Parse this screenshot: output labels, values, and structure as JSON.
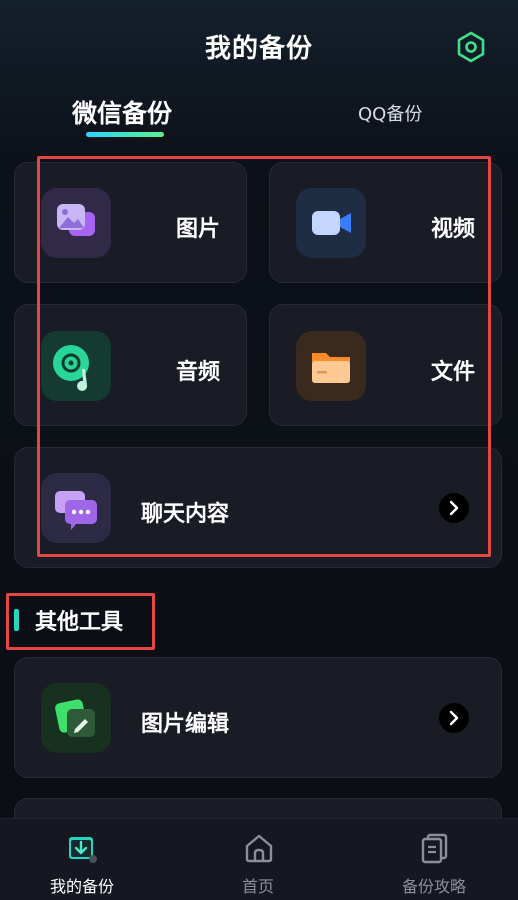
{
  "header": {
    "title": "我的备份",
    "settings_icon": "hexagon-settings-icon"
  },
  "tabs": [
    {
      "label": "微信备份",
      "active": true
    },
    {
      "label": "QQ备份",
      "active": false
    }
  ],
  "backup_items": [
    {
      "label": "图片",
      "icon": "photo-icon"
    },
    {
      "label": "视频",
      "icon": "video-icon"
    },
    {
      "label": "音频",
      "icon": "music-disc-icon"
    },
    {
      "label": "文件",
      "icon": "folder-icon"
    },
    {
      "label": "聊天内容",
      "icon": "chat-bubble-icon"
    }
  ],
  "other_tools": {
    "title": "其他工具",
    "items": [
      {
        "label": "图片编辑",
        "icon": "image-edit-icon"
      }
    ]
  },
  "bottom_nav": [
    {
      "label": "我的备份",
      "active": true,
      "icon": "backup-download-icon"
    },
    {
      "label": "首页",
      "active": false,
      "icon": "home-icon"
    },
    {
      "label": "备份攻略",
      "active": false,
      "icon": "documents-icon"
    }
  ],
  "colors": {
    "accent_teal": "#27d6c0",
    "highlight_red": "#e54646",
    "card_bg": "#1a1c25",
    "active_nav_text": "#ffffff",
    "inactive_nav_text": "#8a8f99"
  }
}
